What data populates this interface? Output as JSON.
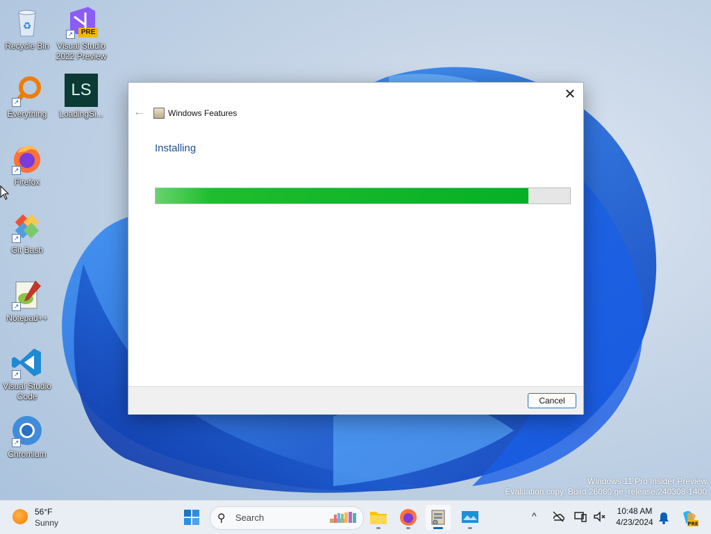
{
  "desktop": {
    "icons": [
      {
        "label": "Recycle Bin",
        "icon": "recycle-bin-icon"
      },
      {
        "label": "Visual Studio 2022 Preview",
        "icon": "visual-studio-preview-icon",
        "badge": "PRE"
      },
      {
        "label": "Everything",
        "icon": "everything-search-icon"
      },
      {
        "label": "LoadingSi...",
        "icon": "loadingsi-icon",
        "badge": "LS"
      },
      {
        "label": "Firefox",
        "icon": "firefox-icon"
      },
      {
        "label": "Git Bash",
        "icon": "git-bash-icon"
      },
      {
        "label": "Notepad++",
        "icon": "notepad-plus-plus-icon"
      },
      {
        "label": "Visual Studio Code",
        "icon": "vscode-icon"
      },
      {
        "label": "Chromium",
        "icon": "chromium-icon"
      }
    ]
  },
  "dialog": {
    "title": "Windows Features",
    "heading": "Installing",
    "progress_percent": 90,
    "cancel_label": "Cancel",
    "close_glyph": "✕",
    "back_glyph": "←"
  },
  "watermark": {
    "line1": "Windows 11 Pro Insider Preview",
    "line2": "Evaluation copy. Build 26080.ge_release.240308-1400"
  },
  "taskbar": {
    "weather_temp": "56°F",
    "weather_condition": "Sunny",
    "search_placeholder": "Search",
    "apps": [
      "windows-start-icon",
      "file-explorer-icon",
      "firefox-icon",
      "windows-features-icon",
      "remote-desktop-icon"
    ],
    "clock_time": "10:48 AM",
    "clock_date": "4/23/2024",
    "tray_chevron": "^"
  },
  "colors": {
    "accent": "#0067c0",
    "progress_green": "#06b025",
    "heading_blue": "#1f4f8f"
  }
}
